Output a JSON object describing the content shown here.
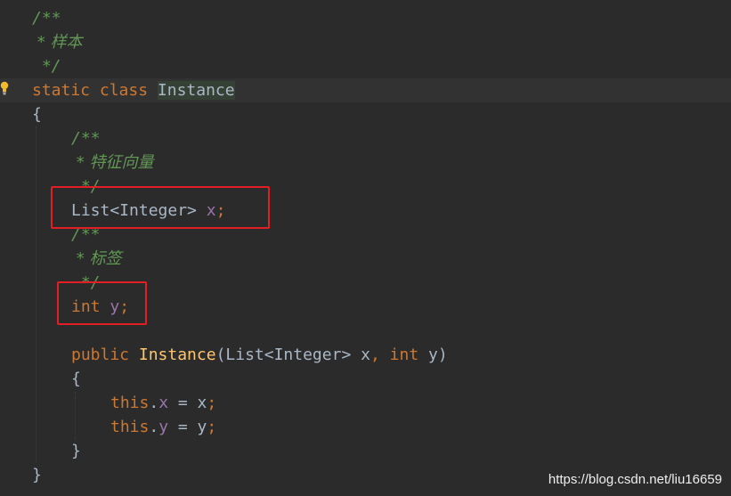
{
  "editor": {
    "lines": [
      [
        {
          "t": "/**",
          "c": "c-comment"
        }
      ],
      [
        {
          "t": " * 样本",
          "c": "c-comment c-doc-cn"
        }
      ],
      [
        {
          "t": " */",
          "c": "c-comment"
        }
      ],
      [
        {
          "t": "static class ",
          "c": "c-keyword"
        },
        {
          "t": "Instance",
          "c": "c-class-decl"
        }
      ],
      [
        {
          "t": "{",
          "c": "c-plain"
        }
      ],
      [
        {
          "t": "/**",
          "c": "c-comment"
        }
      ],
      [
        {
          "t": " * 特征向量",
          "c": "c-comment c-doc-cn"
        }
      ],
      [
        {
          "t": " */",
          "c": "c-comment"
        }
      ],
      [
        {
          "t": "List<Integer> ",
          "c": "c-type"
        },
        {
          "t": "x",
          "c": "c-field"
        },
        {
          "t": ";",
          "c": "c-punct"
        }
      ],
      [
        {
          "t": "/**",
          "c": "c-comment"
        }
      ],
      [
        {
          "t": " * 标签",
          "c": "c-comment c-doc-cn"
        }
      ],
      [
        {
          "t": " */",
          "c": "c-comment"
        }
      ],
      [
        {
          "t": "int ",
          "c": "c-keyword"
        },
        {
          "t": "y",
          "c": "c-field"
        },
        {
          "t": ";",
          "c": "c-punct"
        }
      ],
      [],
      [
        {
          "t": "public ",
          "c": "c-keyword"
        },
        {
          "t": "Instance",
          "c": "c-method"
        },
        {
          "t": "(List<Integer> x",
          "c": "c-plain"
        },
        {
          "t": ", ",
          "c": "c-punct"
        },
        {
          "t": "int ",
          "c": "c-keyword"
        },
        {
          "t": "y)",
          "c": "c-plain"
        }
      ],
      [
        {
          "t": "{",
          "c": "c-plain"
        }
      ],
      [
        {
          "t": "this",
          "c": "c-keyword"
        },
        {
          "t": ".",
          "c": "c-plain"
        },
        {
          "t": "x",
          "c": "c-field"
        },
        {
          "t": " = x",
          "c": "c-plain"
        },
        {
          "t": ";",
          "c": "c-punct"
        }
      ],
      [
        {
          "t": "this",
          "c": "c-keyword"
        },
        {
          "t": ".",
          "c": "c-plain"
        },
        {
          "t": "y",
          "c": "c-field"
        },
        {
          "t": " = y",
          "c": "c-plain"
        },
        {
          "t": ";",
          "c": "c-punct"
        }
      ],
      [
        {
          "t": "}",
          "c": "c-plain"
        }
      ],
      [
        {
          "t": "}",
          "c": "c-plain"
        }
      ]
    ],
    "current_line_index": 3,
    "bulb_icon": "lightbulb-icon",
    "highlight_color": "#e31e24"
  },
  "watermark": "https://blog.csdn.net/liu16659"
}
